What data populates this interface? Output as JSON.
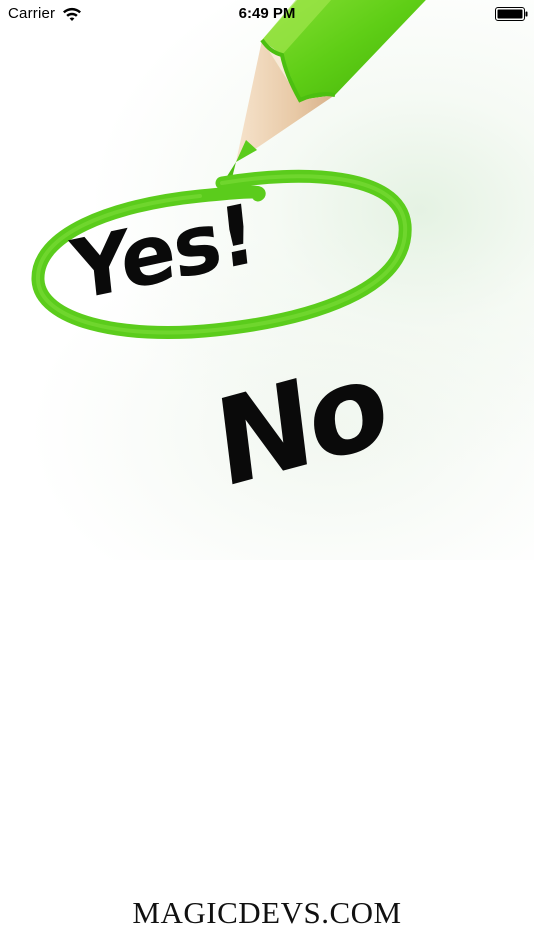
{
  "status_bar": {
    "carrier": "Carrier",
    "time": "6:49 PM",
    "icons": [
      "wifi-icon",
      "battery-icon"
    ]
  },
  "splash": {
    "yes_label": "Yes!",
    "no_label": "No",
    "selected_option": "Yes!",
    "accent_color": "#5bcc1c"
  },
  "footer": {
    "brand": "MAGICDEVS.COM"
  }
}
